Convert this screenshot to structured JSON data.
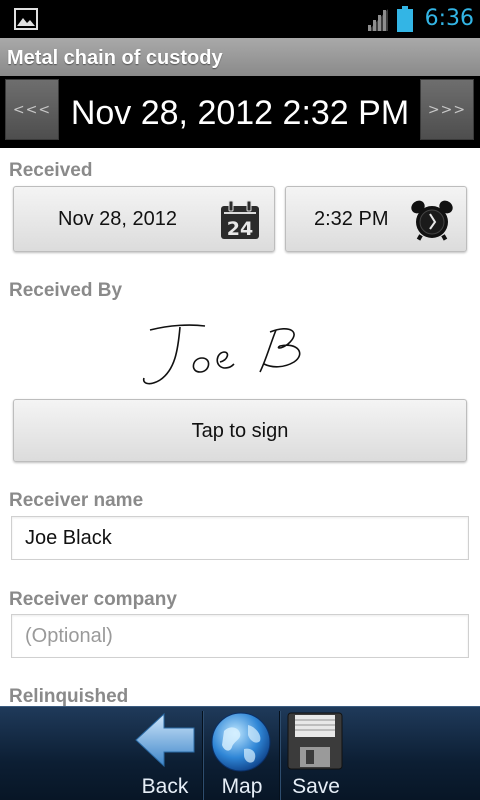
{
  "status_bar": {
    "time": "6:36"
  },
  "app": {
    "title": "Metal chain of custody"
  },
  "date_nav": {
    "prev": "<<<",
    "current": "Nov 28, 2012 2:32 PM",
    "next": ">>>"
  },
  "received": {
    "label": "Received",
    "date": "Nov 28, 2012",
    "calendar_day": "24",
    "time": "2:32 PM"
  },
  "received_by": {
    "label": "Received By",
    "sign_button": "Tap to sign"
  },
  "receiver_name": {
    "label": "Receiver name",
    "value": "Joe Black"
  },
  "receiver_company": {
    "label": "Receiver company",
    "value": "",
    "placeholder": "(Optional)"
  },
  "relinquished": {
    "label": "Relinquished"
  },
  "bottom_bar": {
    "back": "Back",
    "map": "Map",
    "save": "Save"
  },
  "colors": {
    "accent": "#33b5e5",
    "bottom_bar": "#0c1e33",
    "label_gray": "#8a8a8a"
  },
  "icons": [
    "picture-notification-icon",
    "signal-icon",
    "battery-icon",
    "calendar-icon",
    "alarm-clock-icon",
    "back-arrow-icon",
    "globe-icon",
    "floppy-disk-icon"
  ]
}
